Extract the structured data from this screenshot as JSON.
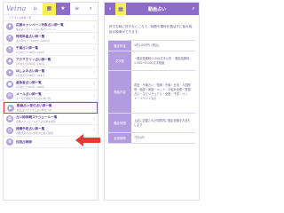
{
  "colors": {
    "accent_purple": "#8c6cc8",
    "highlight_yellow": "#f7ef56",
    "arrow_red": "#e23b3b",
    "table_header": "#b39be0"
  },
  "left": {
    "logo": "Vetria",
    "nav_icons": [
      "home-icon",
      "calendar-icon",
      "star-icon",
      "menu-icon",
      "search-icon"
    ],
    "rows": [
      {
        "title": "",
        "sub": "クラウド占術師一覧…",
        "icon": "person-icon"
      },
      {
        "title": "応援キャンペーン対象占い師一覧",
        "sub": "電話占いアイリス占い師のイベント",
        "icon": "gift-icon"
      },
      {
        "title": "特別料金占い師一覧",
        "sub": "占い師サイン120分～1000円",
        "icon": "yen-icon"
      },
      {
        "title": "千葉占い師一覧",
        "sub": "1分あたり100円～190円",
        "icon": "yen-icon"
      },
      {
        "title": "アクアマリン占い師一覧",
        "sub": "1分あたり200円～290円",
        "icon": "gem-icon"
      },
      {
        "title": "ほしよみ占い師一覧",
        "sub": "1分あたり300円～390円",
        "icon": "star-icon"
      },
      {
        "title": "金魚星占い師一覧",
        "sub": "1分あたり400円～490円",
        "icon": "fish-icon"
      },
      {
        "title": "メール占い師一覧",
        "sub": "メールで相談できる占い師一覧",
        "icon": "mail-icon"
      },
      {
        "title": "動画占い受付占い師一覧",
        "sub": "動画占いができる占い師を一覧",
        "icon": "video-icon"
      },
      {
        "title": "占い師待機スケジュール一覧",
        "sub": "待機スケジュールから占い師を確認",
        "icon": "calendar-icon"
      },
      {
        "title": "待機予定占い師一覧",
        "sub": "待機予定の占い師をまとめて確認",
        "icon": "clock-icon"
      },
      {
        "title": "伝説占術師",
        "sub": "",
        "icon": "crown-icon"
      }
    ]
  },
  "right": {
    "header_title": "動画占い",
    "description": "好きな時に好きなところで、時間や場所を選ばずに悩み相談の映像ができます。",
    "table": [
      {
        "label": "鑑定料金",
        "value": "1件1,000円（税込）"
      },
      {
        "label": "文字数",
        "value": "・鑑定依頼時 2,000文字以内 ・鑑定結果時 1,500～3,000文字程度"
      },
      {
        "label": "相談内容",
        "value": "恋愛・不倫占い・復縁・不倫・仕事・人間関係・健康・家庭・ペット・お悩み全般・霊視占い・スピリチュアル・全般・子供・ペット・イベントなど"
      },
      {
        "label": "鑑定時間",
        "value": "上記に記載された時間内に鑑定依頼をお送りします"
      },
      {
        "label": "返信期限",
        "value": "7日以内"
      }
    ]
  }
}
